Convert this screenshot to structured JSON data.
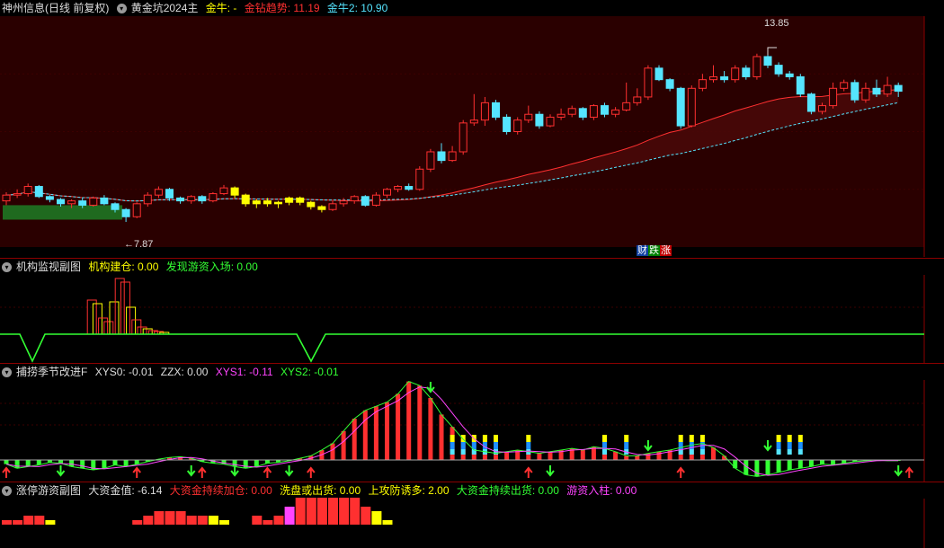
{
  "main": {
    "app": "神州信息",
    "period": "(日线 前复权)",
    "formula": "黄金坑2024主",
    "items": [
      {
        "label": "金牛: -",
        "color": "#ffff00"
      },
      {
        "label": "金钻趋势: 11.19",
        "color": "#ff3030"
      },
      {
        "label": "金牛2: 10.90",
        "color": "#55e5ff"
      }
    ],
    "high_label": "13.85",
    "low_label": "7.87",
    "badges": [
      "财",
      "跌",
      "涨"
    ]
  },
  "sub1": {
    "title": "机构监视副图",
    "items": [
      {
        "label": "机构建仓: 0.00",
        "color": "#ffff00"
      },
      {
        "label": "发现游资入场: 0.00",
        "color": "#33ff33"
      }
    ]
  },
  "sub2": {
    "title": "捕捞季节改进F",
    "items": [
      {
        "label": "XYS0: -0.01",
        "color": "#dddddd"
      },
      {
        "label": "ZZX: 0.00",
        "color": "#dddddd"
      },
      {
        "label": "XYS1: -0.11",
        "color": "#ff44ff"
      },
      {
        "label": "XYS2: -0.01",
        "color": "#33ff33"
      }
    ]
  },
  "sub3": {
    "title": "涨停游资副图",
    "items": [
      {
        "label": "大资金值: -6.14",
        "color": "#dddddd"
      },
      {
        "label": "大资金持续加仓: 0.00",
        "color": "#ff3030"
      },
      {
        "label": "洗盘或出货: 0.00",
        "color": "#ffff00"
      },
      {
        "label": "上攻防诱多: 2.00",
        "color": "#ffff00"
      },
      {
        "label": "大资金持续出货: 0.00",
        "color": "#33ff33"
      },
      {
        "label": "游资入柱: 0.00",
        "color": "#ff44ff"
      }
    ]
  },
  "colors": {
    "up": "#ff3030",
    "down": "#55e5ff",
    "gold": "#ffff00",
    "green": "#33ff33",
    "magenta": "#ff44ff",
    "grid": "#8b0000"
  },
  "chart_data": [
    {
      "type": "candlestick",
      "ylim": [
        7.0,
        15.0
      ],
      "high": 13.85,
      "low": 7.87,
      "candles": [
        [
          8.6,
          8.8,
          8.45,
          8.9
        ],
        [
          8.8,
          8.85,
          8.7,
          9.0
        ],
        [
          8.85,
          9.1,
          8.75,
          9.2
        ],
        [
          9.1,
          8.75,
          8.7,
          9.15
        ],
        [
          8.75,
          8.65,
          8.55,
          8.8
        ],
        [
          8.65,
          8.5,
          8.4,
          8.7
        ],
        [
          8.5,
          8.6,
          8.35,
          8.65
        ],
        [
          8.6,
          8.45,
          8.35,
          8.7
        ],
        [
          8.45,
          8.7,
          8.4,
          8.75
        ],
        [
          8.7,
          8.5,
          8.45,
          8.8
        ],
        [
          8.5,
          8.3,
          8.2,
          8.55
        ],
        [
          8.3,
          8.05,
          7.87,
          8.35
        ],
        [
          8.05,
          8.5,
          8.0,
          8.55
        ],
        [
          8.5,
          8.8,
          8.4,
          8.9
        ],
        [
          8.8,
          9.0,
          8.7,
          9.1
        ],
        [
          9.0,
          8.7,
          8.6,
          9.05
        ],
        [
          8.7,
          8.6,
          8.5,
          8.75
        ],
        [
          8.6,
          8.75,
          8.5,
          8.8
        ],
        [
          8.75,
          8.6,
          8.5,
          8.8
        ],
        [
          8.6,
          8.85,
          8.55,
          8.9
        ],
        [
          8.85,
          9.05,
          8.8,
          9.15
        ],
        [
          9.05,
          8.8,
          8.7,
          9.1
        ],
        [
          8.8,
          8.5,
          8.4,
          8.85
        ],
        [
          8.5,
          8.6,
          8.35,
          8.65
        ],
        [
          8.6,
          8.5,
          8.4,
          8.7
        ],
        [
          8.5,
          8.55,
          8.35,
          8.6
        ],
        [
          8.55,
          8.7,
          8.45,
          8.75
        ],
        [
          8.7,
          8.55,
          8.45,
          8.75
        ],
        [
          8.55,
          8.4,
          8.3,
          8.6
        ],
        [
          8.4,
          8.3,
          8.2,
          8.45
        ],
        [
          8.3,
          8.5,
          8.25,
          8.6
        ],
        [
          8.5,
          8.6,
          8.4,
          8.7
        ],
        [
          8.6,
          8.75,
          8.5,
          8.8
        ],
        [
          8.75,
          8.45,
          8.4,
          8.8
        ],
        [
          8.45,
          8.8,
          8.4,
          8.9
        ],
        [
          8.8,
          9.0,
          8.7,
          9.05
        ],
        [
          9.0,
          9.1,
          8.9,
          9.15
        ],
        [
          9.1,
          9.0,
          8.95,
          9.2
        ],
        [
          9.0,
          9.7,
          8.95,
          9.8
        ],
        [
          9.7,
          10.3,
          9.6,
          10.4
        ],
        [
          10.3,
          10.0,
          9.9,
          10.6
        ],
        [
          10.0,
          10.3,
          9.95,
          10.5
        ],
        [
          10.3,
          11.3,
          10.2,
          11.4
        ],
        [
          11.3,
          11.4,
          11.2,
          12.3
        ],
        [
          11.4,
          12.0,
          11.2,
          12.2
        ],
        [
          12.0,
          11.5,
          11.4,
          12.1
        ],
        [
          11.5,
          11.0,
          10.9,
          11.6
        ],
        [
          11.0,
          11.4,
          10.9,
          11.5
        ],
        [
          11.4,
          11.6,
          11.3,
          11.9
        ],
        [
          11.6,
          11.2,
          11.1,
          11.7
        ],
        [
          11.2,
          11.5,
          11.15,
          11.6
        ],
        [
          11.5,
          11.6,
          11.4,
          11.8
        ],
        [
          11.6,
          11.8,
          11.5,
          11.9
        ],
        [
          11.8,
          11.5,
          11.4,
          11.85
        ],
        [
          11.5,
          11.9,
          11.4,
          11.95
        ],
        [
          11.9,
          11.6,
          11.5,
          12.0
        ],
        [
          11.6,
          11.75,
          11.5,
          11.85
        ],
        [
          11.75,
          12.0,
          11.7,
          12.7
        ],
        [
          12.0,
          12.2,
          11.9,
          12.5
        ],
        [
          12.2,
          13.2,
          12.1,
          13.3
        ],
        [
          13.2,
          12.8,
          12.75,
          13.3
        ],
        [
          12.8,
          12.5,
          12.4,
          12.85
        ],
        [
          12.5,
          11.2,
          11.1,
          12.55
        ],
        [
          11.2,
          12.5,
          11.15,
          12.6
        ],
        [
          12.5,
          12.8,
          12.4,
          13.0
        ],
        [
          12.8,
          12.9,
          12.7,
          13.3
        ],
        [
          12.9,
          12.8,
          12.7,
          13.1
        ],
        [
          12.8,
          13.2,
          12.7,
          13.3
        ],
        [
          13.2,
          12.9,
          12.8,
          13.3
        ],
        [
          12.9,
          13.6,
          12.8,
          13.7
        ],
        [
          13.6,
          13.3,
          13.2,
          13.85
        ],
        [
          13.3,
          13.0,
          12.9,
          13.4
        ],
        [
          13.0,
          12.9,
          12.8,
          13.1
        ],
        [
          12.9,
          12.3,
          12.2,
          13.0
        ],
        [
          12.3,
          11.7,
          11.6,
          12.35
        ],
        [
          11.7,
          11.9,
          11.6,
          12.0
        ],
        [
          11.9,
          12.5,
          11.8,
          12.7
        ],
        [
          12.5,
          12.7,
          12.4,
          12.8
        ],
        [
          12.7,
          12.1,
          12.0,
          12.8
        ],
        [
          12.1,
          12.5,
          12.0,
          12.7
        ],
        [
          12.5,
          12.3,
          12.2,
          12.8
        ],
        [
          12.3,
          12.6,
          12.2,
          12.9
        ],
        [
          12.6,
          12.4,
          12.2,
          12.7
        ]
      ]
    },
    {
      "type": "bar",
      "values": [
        0,
        0,
        0,
        0,
        0,
        0,
        0,
        0,
        0,
        0,
        0,
        0,
        0,
        0,
        0,
        0,
        0,
        0,
        0,
        0,
        0,
        0,
        0,
        0,
        0,
        0,
        0,
        0,
        0,
        0,
        0,
        0,
        0,
        0,
        0,
        0,
        0,
        0,
        0,
        0,
        0,
        0,
        0,
        0,
        0,
        0,
        0,
        0,
        0,
        0,
        0,
        0,
        0,
        0,
        0,
        0,
        0,
        0,
        0,
        0,
        0,
        0,
        0,
        0,
        0,
        0,
        0,
        0,
        0,
        0,
        0,
        0,
        0,
        0,
        0,
        0,
        0,
        0,
        0,
        0,
        0,
        0,
        0
      ]
    },
    {
      "type": "bar",
      "series": [
        {
          "values": [
            -0.05,
            -0.1,
            -0.08,
            -0.06,
            -0.03,
            -0.04,
            -0.08,
            -0.1,
            -0.12,
            -0.1,
            -0.06,
            -0.08,
            -0.05,
            -0.02,
            0.01,
            0.03,
            0.04,
            0.02,
            -0.02,
            -0.04,
            -0.05,
            -0.08,
            -0.1,
            -0.08,
            -0.04,
            -0.03,
            -0.01,
            0.02,
            0.05,
            0.12,
            0.2,
            0.35,
            0.5,
            0.6,
            0.65,
            0.7,
            0.8,
            0.95,
            0.9,
            0.75,
            0.55,
            0.4,
            0.25,
            0.12,
            0.1,
            0.08,
            0.1,
            0.12,
            0.1,
            0.08,
            0.1,
            0.12,
            0.14,
            0.12,
            0.16,
            0.14,
            0.1,
            0.05,
            0.05,
            0.08,
            0.1,
            0.12,
            0.15,
            0.18,
            0.2,
            0.15,
            0.05,
            -0.1,
            -0.18,
            -0.2,
            -0.18,
            -0.15,
            -0.12,
            -0.1,
            -0.08,
            -0.05,
            -0.06,
            -0.04,
            -0.02,
            -0.01,
            0.0,
            -0.01,
            -0.01
          ]
        }
      ]
    },
    {
      "type": "bar",
      "values": [
        1,
        1,
        2,
        2,
        1,
        0,
        0,
        0,
        0,
        0,
        0,
        0,
        1,
        2,
        3,
        3,
        3,
        2,
        2,
        2,
        1,
        0,
        0,
        2,
        1,
        2,
        4,
        6,
        6,
        6,
        6,
        6,
        6,
        4,
        3,
        1,
        0,
        0,
        0,
        0,
        0,
        0,
        0,
        0,
        0,
        0,
        0,
        0,
        0,
        0,
        0,
        0,
        0,
        0,
        0,
        0,
        0,
        0,
        0,
        0,
        0,
        0,
        0,
        0,
        0,
        0,
        0,
        0,
        0,
        0,
        0,
        0,
        0,
        0,
        0,
        0,
        0,
        0,
        0,
        0,
        0,
        0,
        0
      ]
    }
  ]
}
